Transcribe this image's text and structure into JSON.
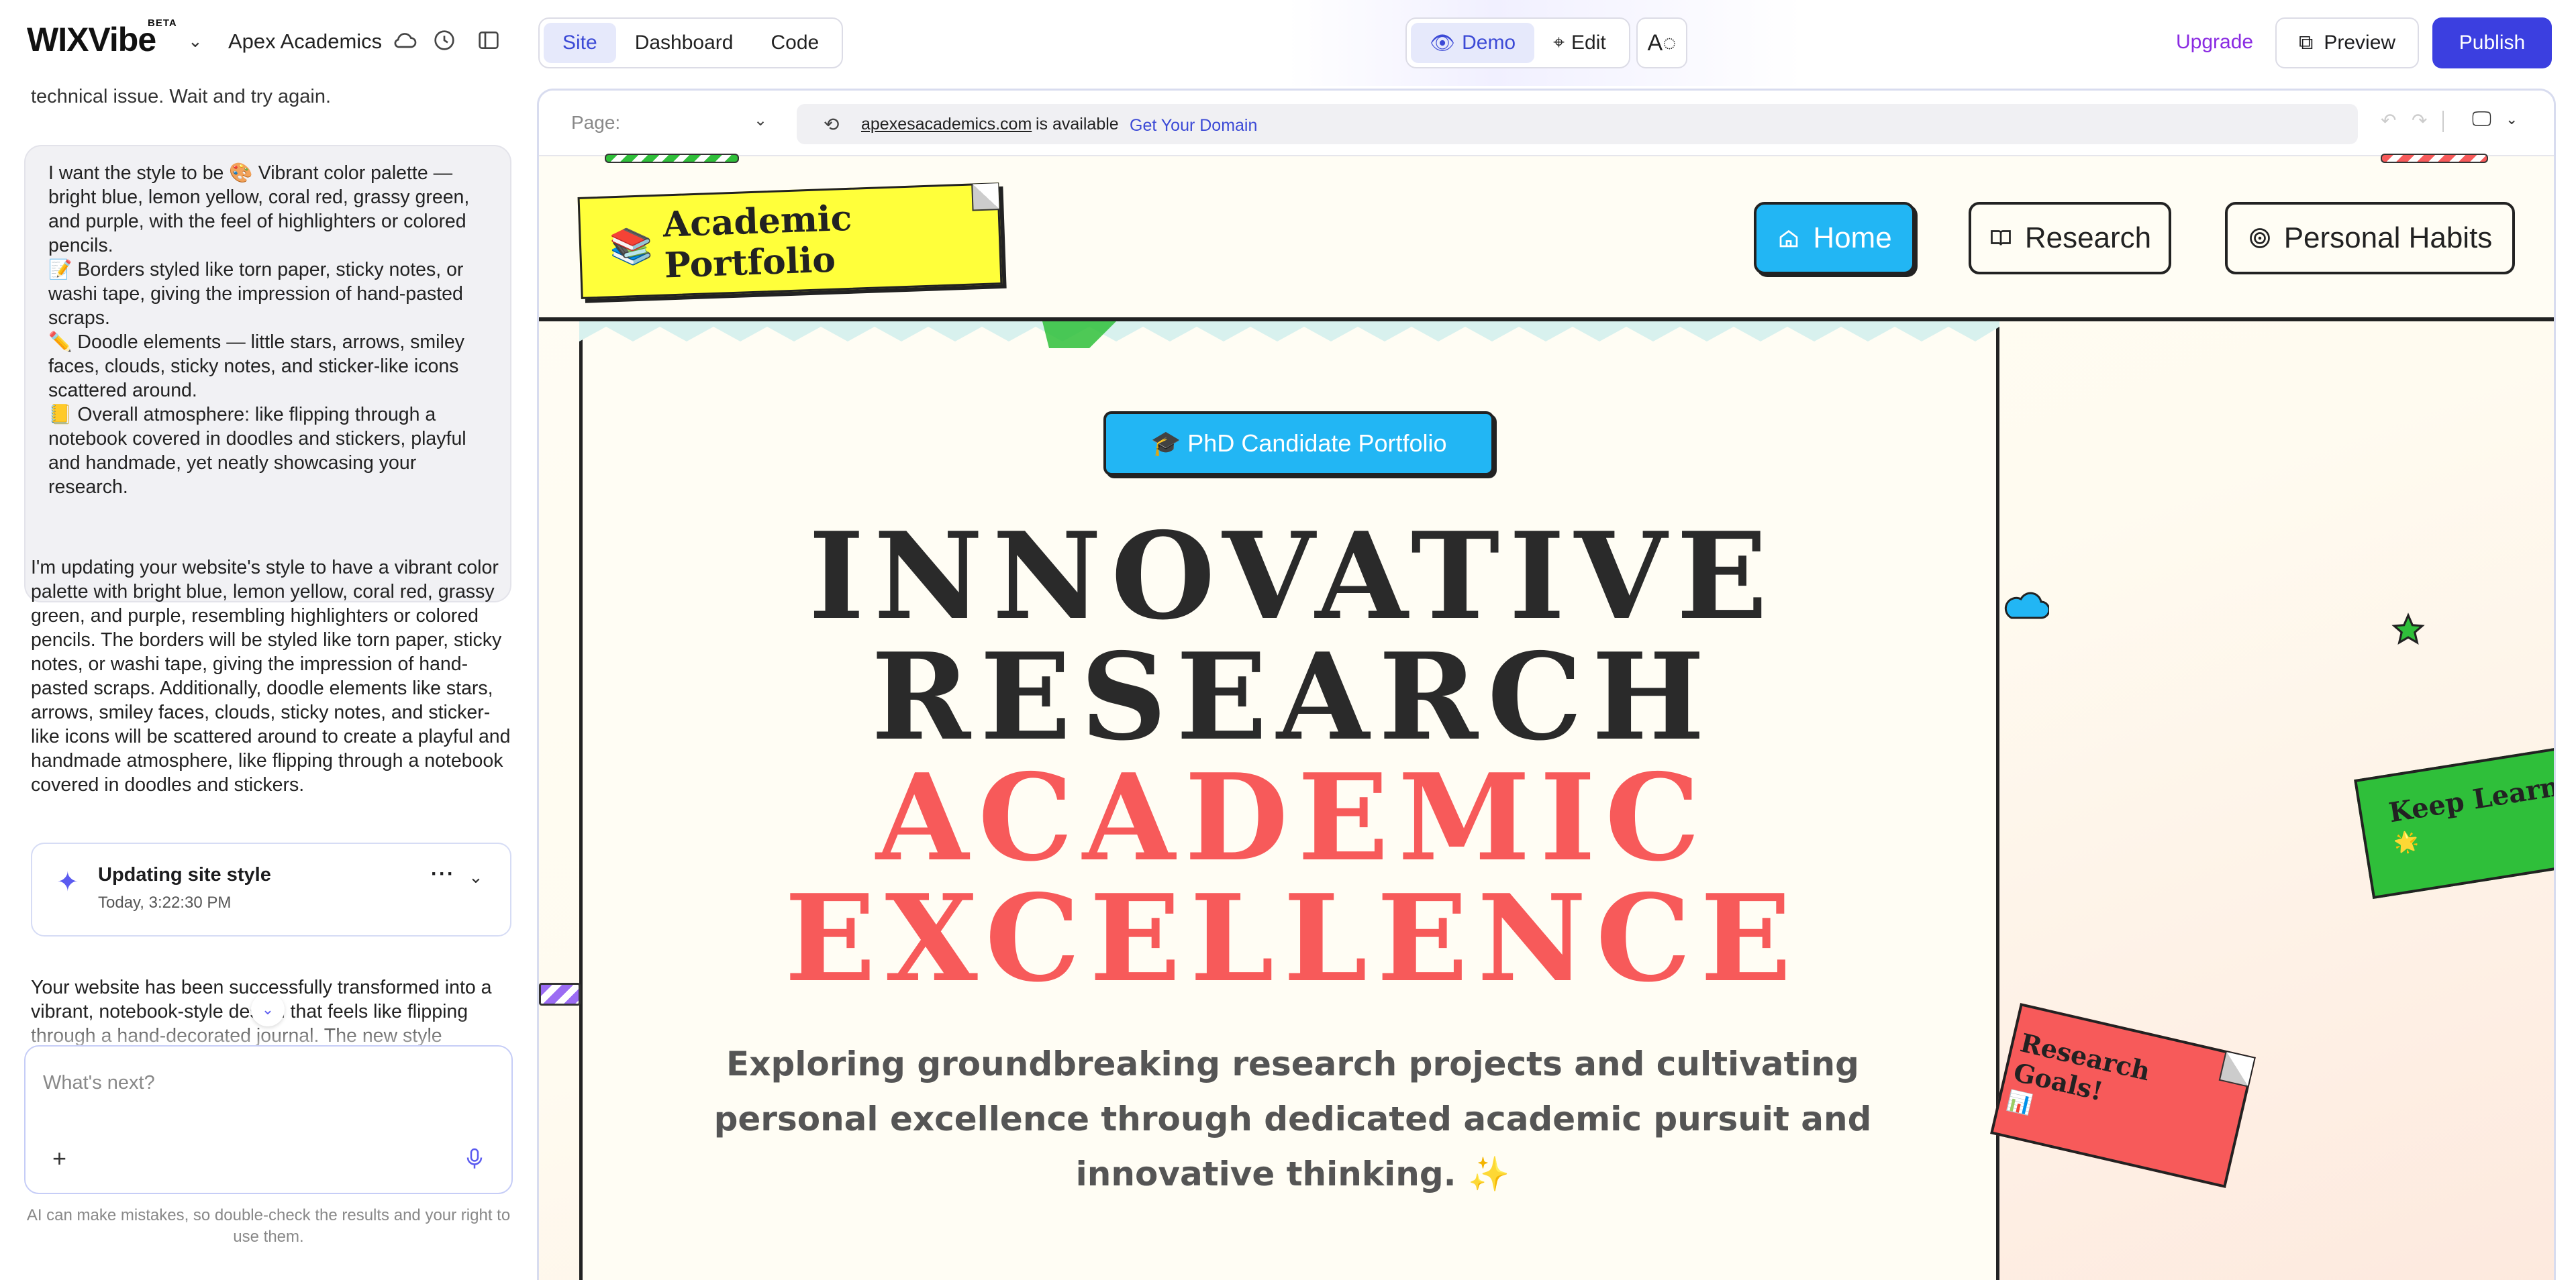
{
  "topbar": {
    "logo": "WIXVibe",
    "beta": "BETA",
    "site_name": "Apex Academics",
    "tabs": [
      {
        "label": "Site"
      },
      {
        "label": "Dashboard"
      },
      {
        "label": "Code"
      }
    ],
    "mode": {
      "demo": "Demo",
      "edit": "Edit"
    },
    "upgrade": "Upgrade",
    "preview": "Preview",
    "publish": "Publish"
  },
  "chat": {
    "cut_text": "technical issue. Wait and try again.",
    "user_message": "I want the style to be 🎨 Vibrant color palette — bright blue, lemon yellow, coral red, grassy green, and purple, with the feel of highlighters or colored pencils.\n📝 Borders styled like torn paper, sticky notes, or washi tape, giving the impression of hand-pasted scraps.\n✏️ Doodle elements — little stars, arrows, smiley faces, clouds, sticky notes, and sticker-like icons scattered around.\n📒 Overall atmosphere: like flipping through a notebook covered in doodles and stickers, playful and handmade, yet neatly showcasing your research.",
    "ai_message": "I'm updating your website's style to have a vibrant color palette with bright blue, lemon yellow, coral red, grassy green, and purple, resembling highlighters or colored pencils. The borders will be styled like torn paper, sticky notes, or washi tape, giving the impression of hand-pasted scraps. Additionally, doodle elements like stars, arrows, smiley faces, clouds, sticky notes, and sticker-like icons will be scattered around to create a playful and handmade atmosphere, like flipping through a notebook covered in doodles and stickers.",
    "status": {
      "title": "Updating site style",
      "time": "Today, 3:22:30 PM"
    },
    "ai_message2": "Your website has been successfully transformed into a vibrant, notebook-style design that feels like flipping through a hand-decorated journal. The new style",
    "composer_placeholder": "What's next?",
    "disclaimer": "AI can make mistakes, so double-check the results and your right to use them."
  },
  "browser": {
    "page_label": "Page:",
    "domain": "apexesacademics.com",
    "available": "is available",
    "get_domain": "Get Your Domain"
  },
  "site": {
    "brand": "Academic Portfolio",
    "brand_emoji": "📚",
    "nav": [
      {
        "label": "Home",
        "icon": "home-icon",
        "active": true
      },
      {
        "label": "Research",
        "icon": "book-icon",
        "active": false
      },
      {
        "label": "Personal Habits",
        "icon": "target-icon",
        "active": false
      }
    ],
    "badge": "🎓 PhD Candidate Portfolio",
    "headline": [
      "INNOVATIVE",
      "RESEARCH",
      "ACADEMIC",
      "EXCELLENCE"
    ],
    "subtitle": "Exploring groundbreaking research projects and cultivating personal excellence through dedicated academic pursuit and innovative thinking. ✨",
    "note_green": "Keep Learning",
    "note_green_emoji": "🌟",
    "note_red": "Research Goals!",
    "note_red_emoji": "📊"
  },
  "colors": {
    "accent": "#3b3fe0",
    "blue": "#22b6f4",
    "yellow": "#ffff3a",
    "coral": "#f75a5a",
    "green": "#2fbf3a",
    "purple": "#9b6cf3"
  }
}
